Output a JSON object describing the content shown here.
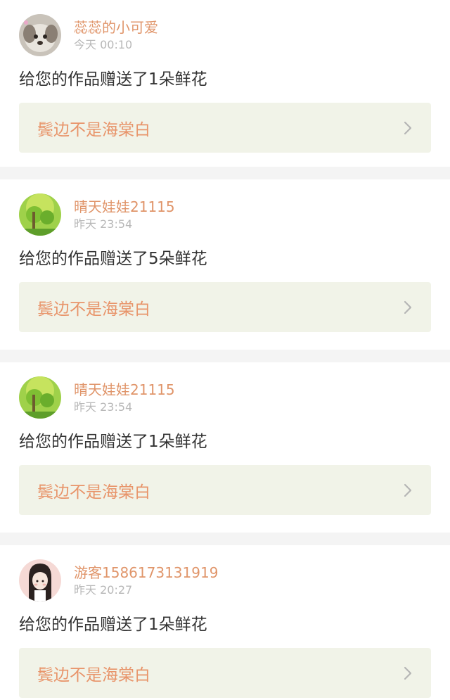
{
  "colors": {
    "name": "#e0956a",
    "time": "#b8b8b8",
    "message": "#333333",
    "link_bg": "#f1f3e8",
    "link_text": "#e8946a",
    "divider": "#f4f4f4"
  },
  "feed": [
    {
      "user_name": "蕊蕊的小可爱",
      "time": "今天 00:10",
      "avatar": "dog-photo-avatar",
      "message": "给您的作品赠送了1朵鲜花",
      "work_title": "鬓边不是海棠白"
    },
    {
      "user_name": "晴天娃娃21115",
      "time": "昨天 23:54",
      "avatar": "green-tree-avatar",
      "message": "给您的作品赠送了5朵鲜花",
      "work_title": "鬓边不是海棠白"
    },
    {
      "user_name": "晴天娃娃21115",
      "time": "昨天 23:54",
      "avatar": "green-tree-avatar",
      "message": "给您的作品赠送了1朵鲜花",
      "work_title": "鬓边不是海棠白"
    },
    {
      "user_name": "游客1586173131919",
      "time": "昨天 20:27",
      "avatar": "girl-illustration-avatar",
      "message": "给您的作品赠送了1朵鲜花",
      "work_title": "鬓边不是海棠白"
    }
  ]
}
